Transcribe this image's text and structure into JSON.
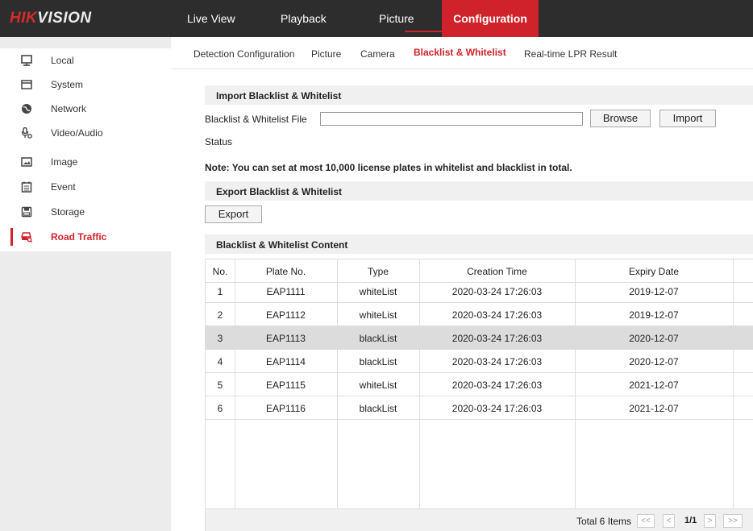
{
  "brand": {
    "part1": "HIK",
    "part2": "VISION"
  },
  "topnav": [
    "Live View",
    "Playback",
    "Picture",
    "Configuration"
  ],
  "sidebar": {
    "items": [
      {
        "label": "Local",
        "icon": "monitor-icon"
      },
      {
        "label": "System",
        "icon": "system-icon"
      },
      {
        "label": "Network",
        "icon": "globe-icon"
      },
      {
        "label": "Video/Audio",
        "icon": "microphone-icon"
      },
      {
        "label": "Image",
        "icon": "image-icon"
      },
      {
        "label": "Event",
        "icon": "event-icon"
      },
      {
        "label": "Storage",
        "icon": "storage-icon"
      },
      {
        "label": "Road Traffic",
        "icon": "road-traffic-icon"
      }
    ]
  },
  "tabs": [
    "Detection Configuration",
    "Picture",
    "Camera",
    "Blacklist & Whitelist",
    "Real-time LPR Result"
  ],
  "import_section": {
    "title": "Import Blacklist & Whitelist",
    "file_label": "Blacklist & Whitelist File",
    "file_value": "",
    "browse": "Browse",
    "import": "Import",
    "status_label": "Status"
  },
  "note": "Note: You can set at most 10,000 license plates in whitelist and blacklist in total.",
  "export_section": {
    "title": "Export Blacklist & Whitelist",
    "export": "Export"
  },
  "content_section": {
    "title": "Blacklist & Whitelist Content"
  },
  "table": {
    "columns": [
      "No.",
      "Plate No.",
      "Type",
      "Creation Time",
      "Expiry Date"
    ],
    "rows": [
      [
        "1",
        "EAP1111",
        "whiteList",
        "2020-03-24 17:26:03",
        "2019-12-07"
      ],
      [
        "2",
        "EAP1112",
        "whiteList",
        "2020-03-24 17:26:03",
        "2019-12-07"
      ],
      [
        "3",
        "EAP1113",
        "blackList",
        "2020-03-24 17:26:03",
        "2020-12-07"
      ],
      [
        "4",
        "EAP1114",
        "blackList",
        "2020-03-24 17:26:03",
        "2020-12-07"
      ],
      [
        "5",
        "EAP1115",
        "whiteList",
        "2020-03-24 17:26:03",
        "2021-12-07"
      ],
      [
        "6",
        "EAP1116",
        "blackList",
        "2020-03-24 17:26:03",
        "2021-12-07"
      ]
    ],
    "selected_row": 3
  },
  "pagination": {
    "total": "Total 6 Items",
    "first": "<<",
    "prev": "<",
    "page": "1/1",
    "next": ">",
    "last": ">>"
  },
  "colors": {
    "accent": "#d0222a",
    "topbar": "#2d2d2d",
    "sidebar_bg": "#ececec",
    "section_bg": "#f0f0f0",
    "selected_row": "#dcdcdc"
  }
}
